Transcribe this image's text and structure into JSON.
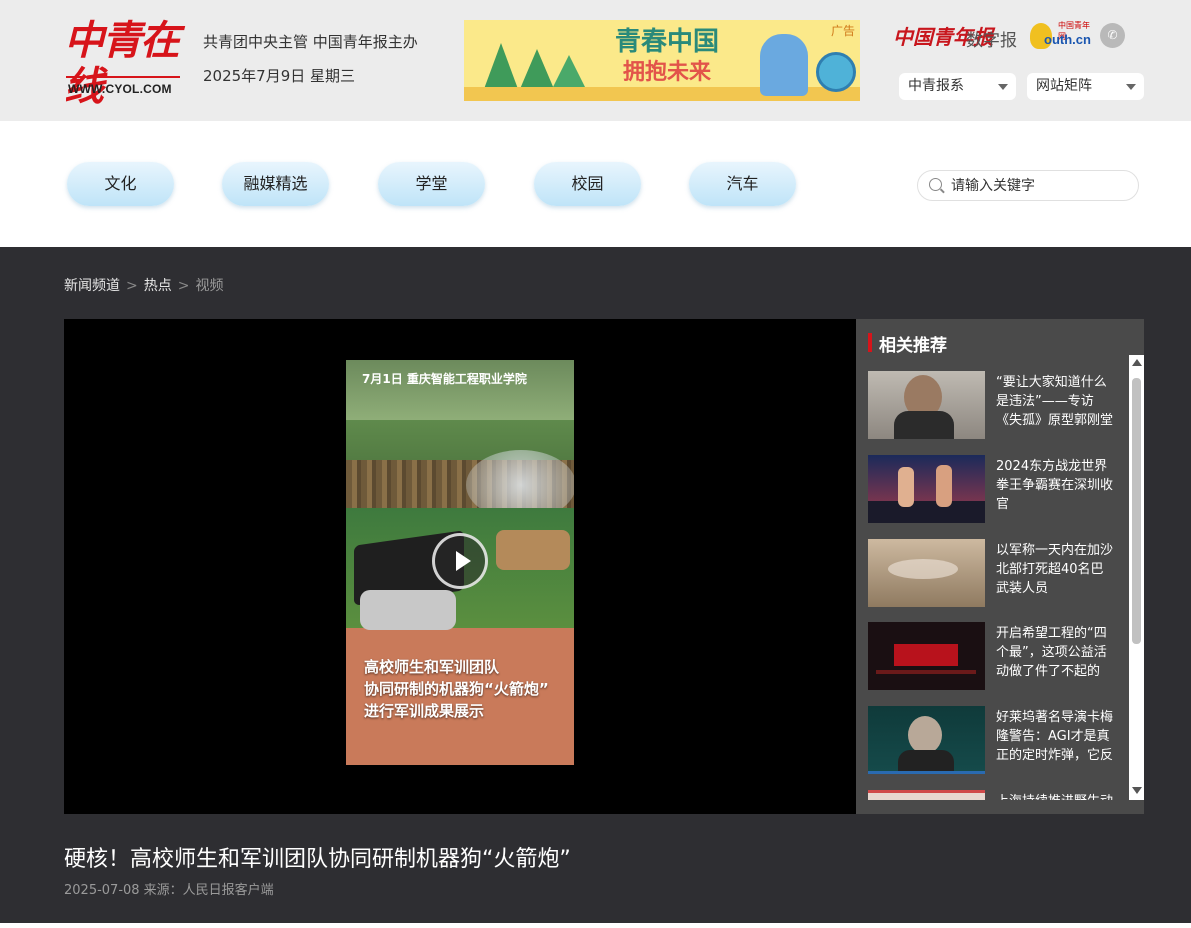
{
  "header": {
    "logo_text": "中青在线",
    "logo_url": "WWW.CYOL.COM",
    "org": "共青团中央主管 中国青年报主办",
    "date": "2025年7月9日 星期三",
    "ad": {
      "label": "广告",
      "title_line1": "青春中国",
      "title_line2": "拥抱未来"
    },
    "brand_cyd": "中国青年报",
    "brand_digital": "数字报",
    "brand_youth_small": "中国青年网",
    "brand_youth": "outh.cn",
    "wechat_icon": "wechat-icon",
    "dropdowns": [
      "中青报系",
      "网站矩阵"
    ]
  },
  "nav": {
    "items": [
      "文化",
      "融媒精选",
      "学堂",
      "校园",
      "汽车"
    ],
    "search_placeholder": "请输入关键字"
  },
  "breadcrumb": {
    "items": [
      "新闻频道",
      "热点"
    ],
    "current": "视频",
    "separator": ">"
  },
  "video": {
    "poster_header": "7月1日 重庆智能工程职业学院",
    "caption_lines": [
      "高校师生和军训团队",
      "协同研制的机器狗“火箭炮”",
      "进行军训成果展示"
    ],
    "play_icon": "play-icon"
  },
  "related": {
    "title": "相关推荐",
    "items": [
      {
        "text": "“要让大家知道什么是违法”——专访《失孤》原型郭刚堂"
      },
      {
        "text": "2024东方战龙世界拳王争霸赛在深圳收官"
      },
      {
        "text": "以军称一天内在加沙北部打死超40名巴武装人员"
      },
      {
        "text": "开启希望工程的“四个最”，这项公益活动做了件了不起的"
      },
      {
        "text": "好莱坞著名导演卡梅隆警告：AGI才是真正的定时炸弹，它反"
      },
      {
        "text": "上海持续推进野生动"
      }
    ]
  },
  "article": {
    "title": "硬核！高校师生和军训团队协同研制机器狗“火箭炮”",
    "meta": "2025-07-08 来源：人民日报客户端"
  },
  "colors": {
    "brand_red": "#d7141a",
    "dark_bg": "#2e2e32",
    "header_bg": "#ececec",
    "nav_pill": "#bfe4f8"
  }
}
